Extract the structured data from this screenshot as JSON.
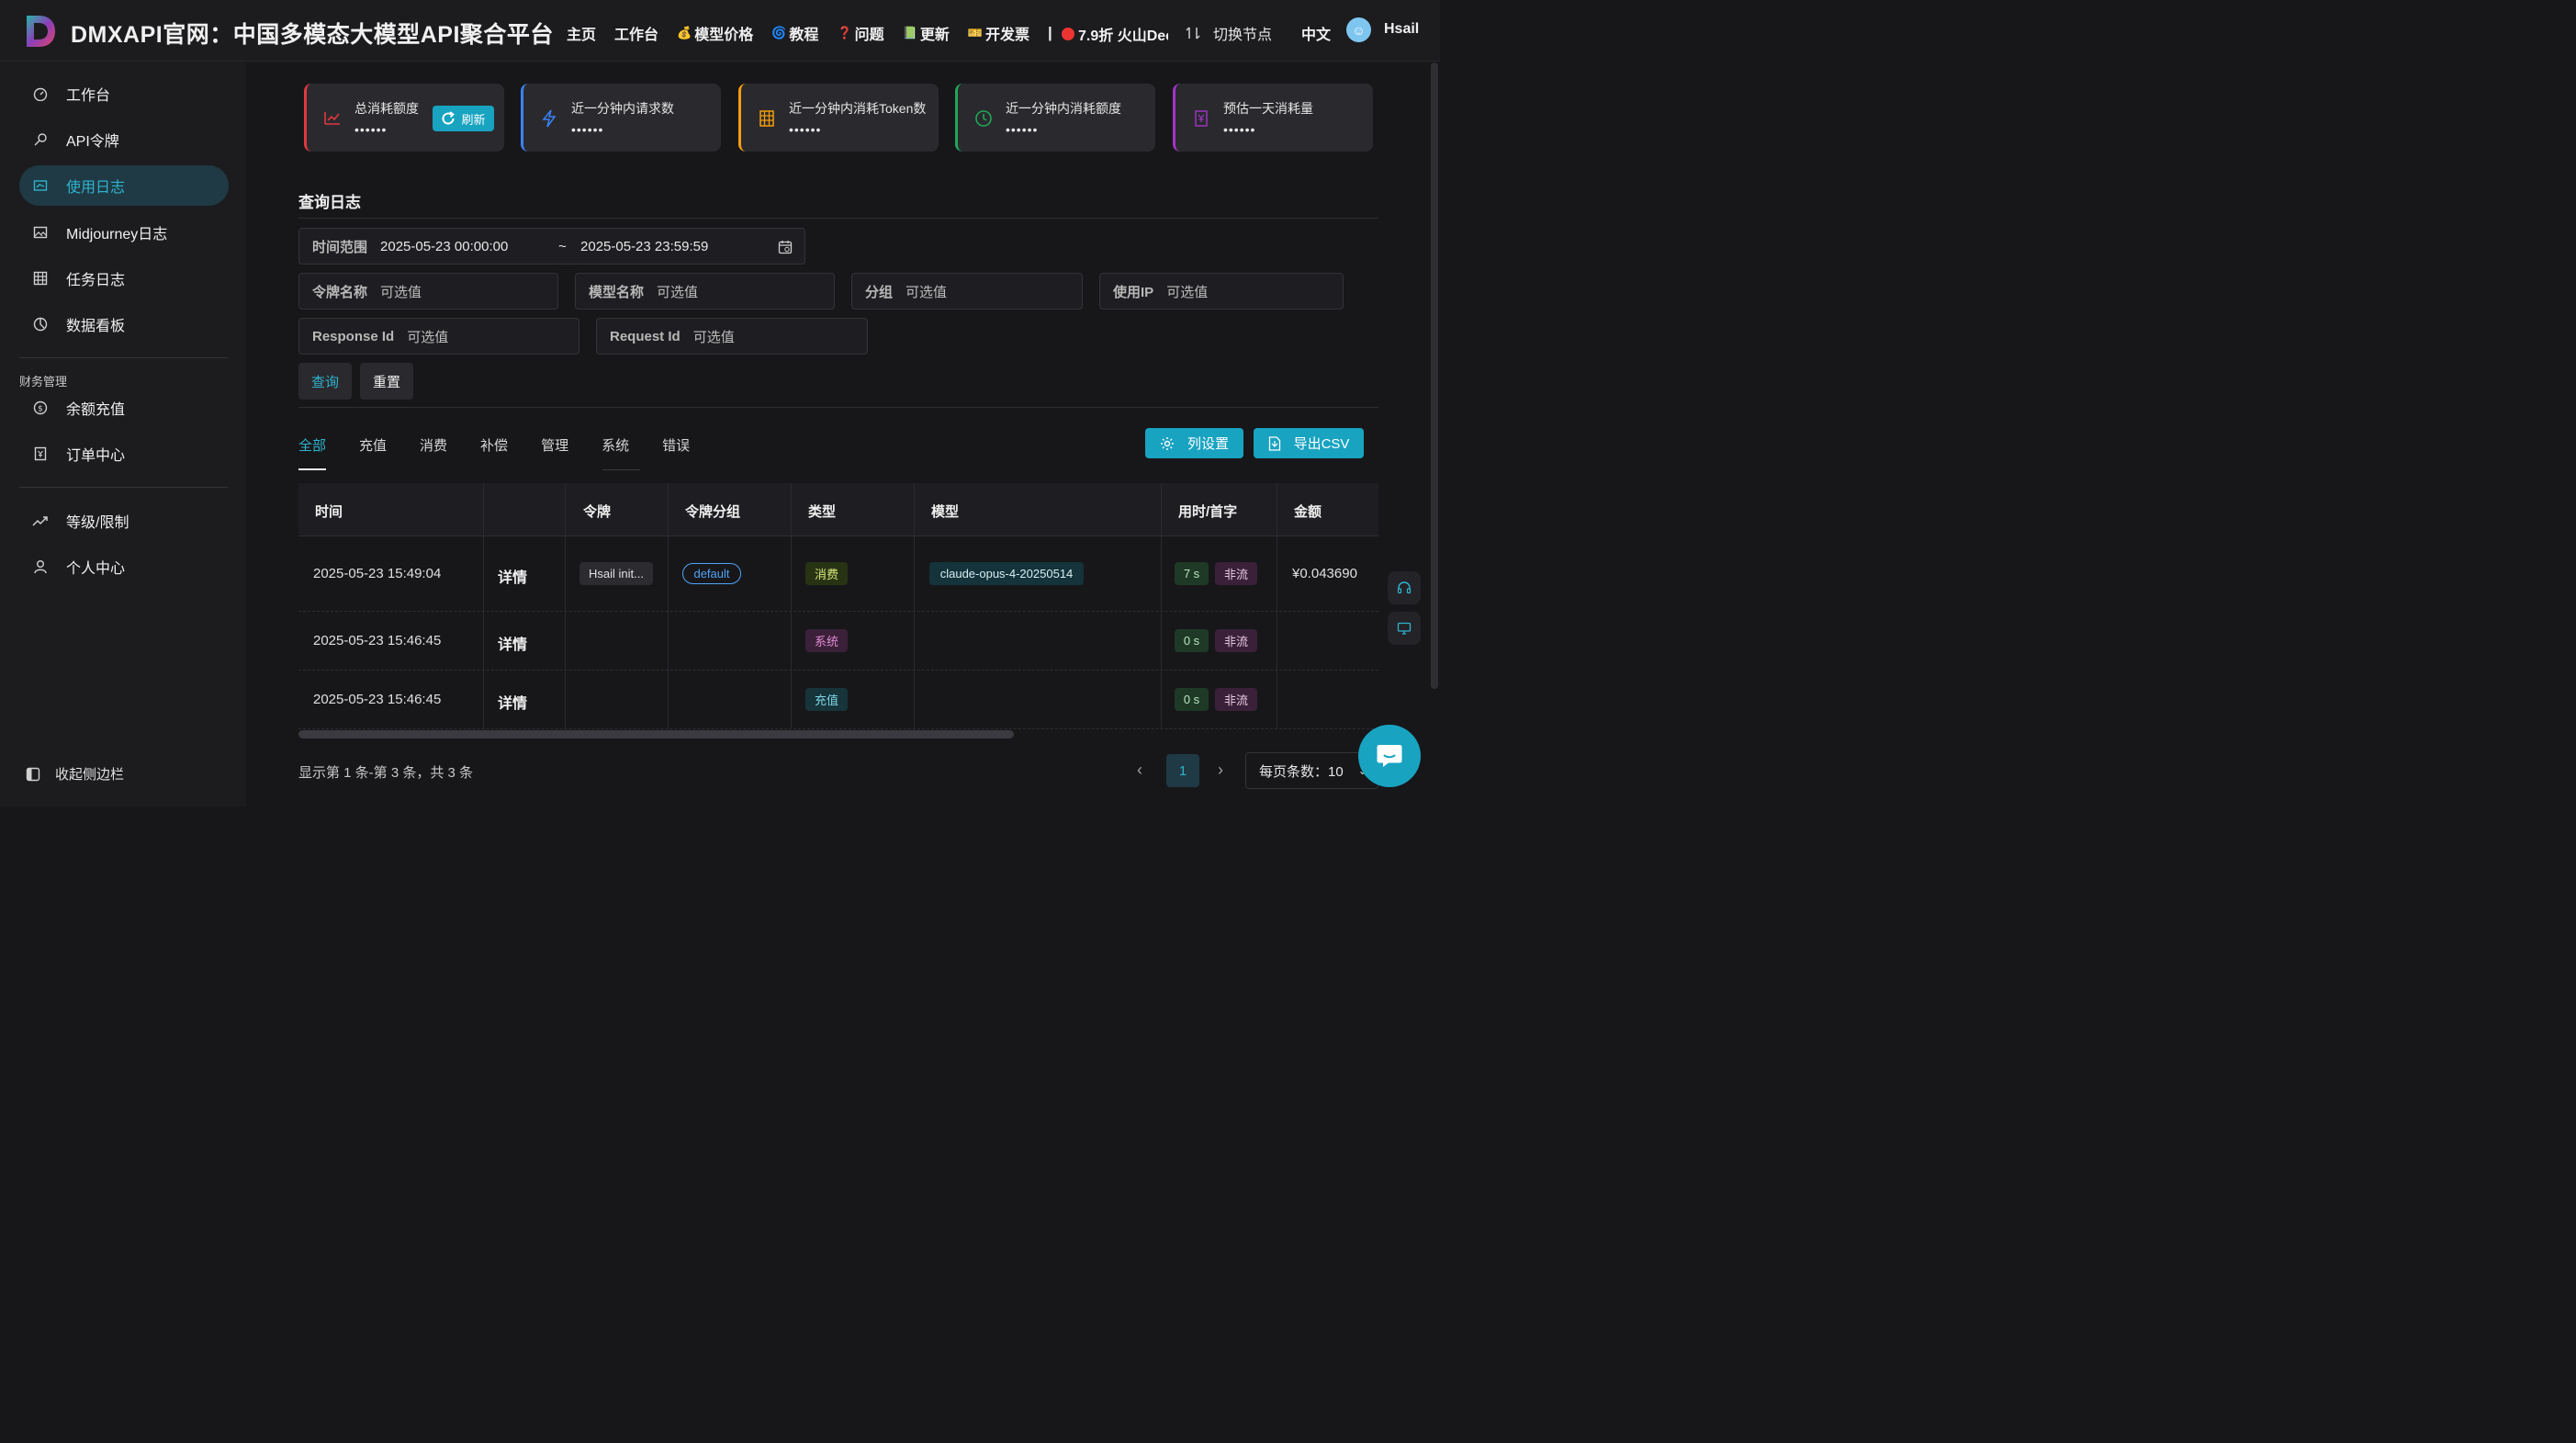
{
  "header": {
    "brand": "DMXAPI官网：中国多模态大模型API聚合平台",
    "nav": [
      {
        "label": "主页",
        "icon": ""
      },
      {
        "label": "工作台",
        "icon": ""
      },
      {
        "label": "模型价格",
        "icon": "💰"
      },
      {
        "label": "教程",
        "icon": "🌀"
      },
      {
        "label": "问题",
        "icon": "❓"
      },
      {
        "label": "更新",
        "icon": "📗"
      },
      {
        "label": "开发票",
        "icon": "🎫"
      }
    ],
    "separator": "|",
    "promo": "7.9折 火山Dee",
    "node_switch": "切换节点",
    "lang": "中文",
    "username": "Hsail"
  },
  "sidebar": {
    "items": [
      {
        "label": "工作台",
        "icon": "dashboard-icon"
      },
      {
        "label": "API令牌",
        "icon": "key-icon"
      },
      {
        "label": "使用日志",
        "icon": "log-icon"
      },
      {
        "label": "Midjourney日志",
        "icon": "image-icon"
      },
      {
        "label": "任务日志",
        "icon": "task-icon"
      },
      {
        "label": "数据看板",
        "icon": "chart-icon"
      }
    ],
    "finance_group": "财务管理",
    "finance_items": [
      {
        "label": "余额充值",
        "icon": "dollar-icon"
      },
      {
        "label": "订单中心",
        "icon": "order-icon"
      }
    ],
    "other_items": [
      {
        "label": "等级/限制",
        "icon": "trend-icon"
      },
      {
        "label": "个人中心",
        "icon": "user-icon"
      }
    ],
    "collapse": "收起侧边栏"
  },
  "stats": [
    {
      "title": "总消耗额度",
      "value": "••••••",
      "color": "#e0383e"
    },
    {
      "title": "近一分钟内请求数",
      "value": "••••••",
      "color": "#3b82f6"
    },
    {
      "title": "近一分钟内消耗Token数",
      "value": "••••••",
      "color": "#f59e0b"
    },
    {
      "title": "近一分钟内消耗额度",
      "value": "••••••",
      "color": "#22a559"
    },
    {
      "title": "预估一天消耗量",
      "value": "••••••",
      "color": "#a233c7"
    }
  ],
  "refresh_label": "刷新",
  "query": {
    "title": "查询日志",
    "time_label": "时间范围",
    "time_start": "2025-05-23 00:00:00",
    "time_sep": "~",
    "time_end": "2025-05-23 23:59:59",
    "token_label": "令牌名称",
    "model_label": "模型名称",
    "group_label": "分组",
    "ip_label": "使用IP",
    "response_label": "Response Id",
    "request_label": "Request Id",
    "placeholder": "可选值",
    "query_btn": "查询",
    "reset_btn": "重置"
  },
  "tabs": [
    "全部",
    "充值",
    "消费",
    "补偿",
    "管理",
    "系统",
    "错误"
  ],
  "actions": {
    "columns": "列设置",
    "export": "导出CSV"
  },
  "table": {
    "headers": [
      "时间",
      "令牌",
      "令牌分组",
      "类型",
      "模型",
      "用时/首字",
      "金额"
    ],
    "rows": [
      {
        "time": "2025-05-23 15:49:04",
        "detail": "详情",
        "token": "Hsail init...",
        "group": "default",
        "type": "消费",
        "type_kind": "consume",
        "model": "claude-opus-4-20250514",
        "duration": "7 s",
        "stream": "非流",
        "amount": "¥0.043690"
      },
      {
        "time": "2025-05-23 15:46:45",
        "detail": "详情",
        "token": "",
        "group": "",
        "type": "系统",
        "type_kind": "system",
        "model": "",
        "duration": "0 s",
        "stream": "非流",
        "amount": ""
      },
      {
        "time": "2025-05-23 15:46:45",
        "detail": "详情",
        "token": "",
        "group": "",
        "type": "充值",
        "type_kind": "recharge",
        "model": "",
        "duration": "0 s",
        "stream": "非流",
        "amount": ""
      }
    ]
  },
  "pagination": {
    "summary": "显示第 1 条-第 3 条，共 3 条",
    "current": "1",
    "page_size": "每页条数：10"
  },
  "colors": {
    "accent": "#18a3c1",
    "active_bg": "#1f3a44"
  }
}
